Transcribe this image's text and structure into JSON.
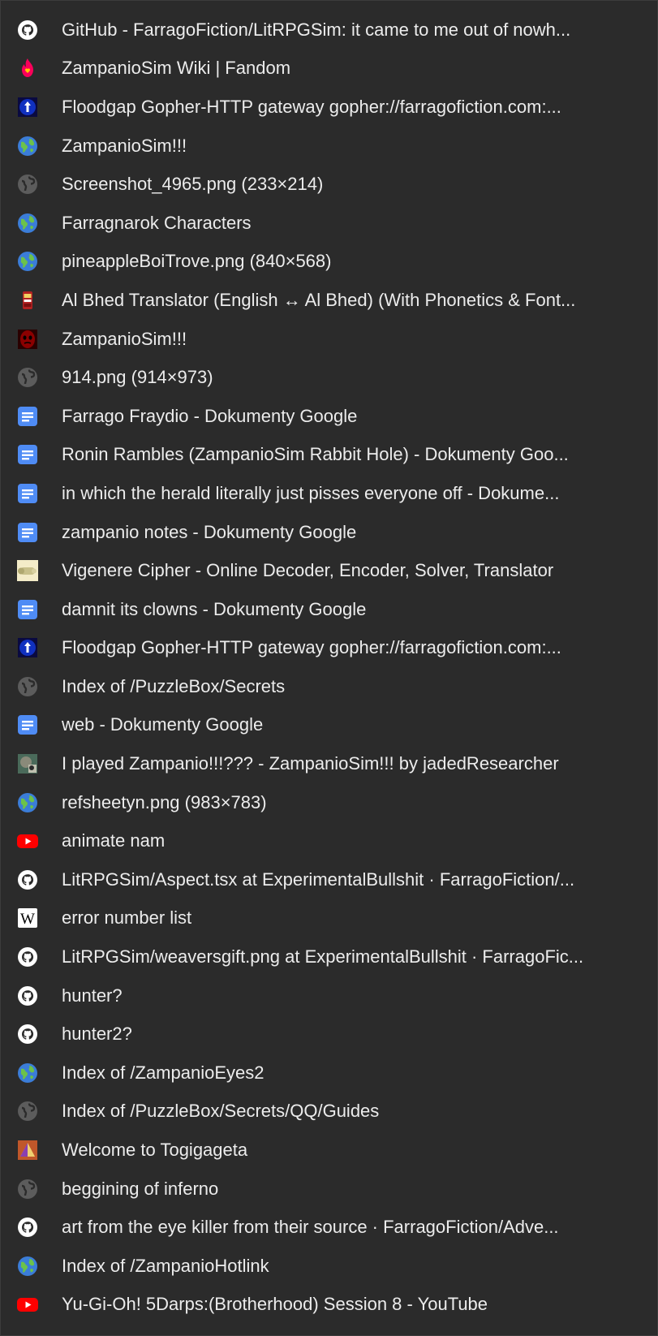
{
  "colors": {
    "menu_background": "#2b2b2b",
    "text": "#ececec",
    "github": "#ffffff",
    "globe_gray": "#5c5c5c",
    "docs_blue": "#4f8cf5",
    "youtube_red": "#ff0000",
    "fandom_pink": "#fa005a",
    "earth_blue": "#3b7dd8",
    "earth_green": "#6cc24a"
  },
  "bookmarks": {
    "items": [
      {
        "icon": "github-icon",
        "title": "GitHub - FarragoFiction/LitRPGSim: it came to me out of nowh..."
      },
      {
        "icon": "fandom-flame-icon",
        "title": "ZampanioSim Wiki | Fandom"
      },
      {
        "icon": "floodgap-icon",
        "title": "Floodgap Gopher-HTTP gateway gopher://farragofiction.com:..."
      },
      {
        "icon": "earth-globe-icon",
        "title": "ZampanioSim!!!"
      },
      {
        "icon": "default-globe-icon",
        "title": "Screenshot_4965.png (233×214)"
      },
      {
        "icon": "earth-globe-icon",
        "title": "Farragnarok Characters"
      },
      {
        "icon": "earth-globe-icon",
        "title": "pineappleBoiTrove.png (840×568)"
      },
      {
        "icon": "al-bhed-icon",
        "title": "Al Bhed Translator (English ↔ Al Bhed) (With Phonetics & Font..."
      },
      {
        "icon": "red-mask-icon",
        "title": "ZampanioSim!!!"
      },
      {
        "icon": "default-globe-icon",
        "title": "914.png (914×973)"
      },
      {
        "icon": "google-docs-icon",
        "title": "Farrago Fraydio - Dokumenty Google"
      },
      {
        "icon": "google-docs-icon",
        "title": "Ronin Rambles (ZampanioSim Rabbit Hole) - Dokumenty Goo..."
      },
      {
        "icon": "google-docs-icon",
        "title": "in which the herald literally just pisses everyone off - Dokume..."
      },
      {
        "icon": "google-docs-icon",
        "title": "zampanio notes - Dokumenty Google"
      },
      {
        "icon": "cipher-scroll-icon",
        "title": "Vigenere Cipher - Online Decoder, Encoder, Solver, Translator"
      },
      {
        "icon": "google-docs-icon",
        "title": "damnit its clowns - Dokumenty Google"
      },
      {
        "icon": "floodgap-icon",
        "title": "Floodgap Gopher-HTTP gateway gopher://farragofiction.com:..."
      },
      {
        "icon": "default-globe-icon",
        "title": "Index of /PuzzleBox/Secrets"
      },
      {
        "icon": "google-docs-icon",
        "title": "web - Dokumenty Google"
      },
      {
        "icon": "itch-avatar-icon",
        "title": "I played Zampanio!!!??? - ZampanioSim!!! by jadedResearcher"
      },
      {
        "icon": "earth-globe-icon",
        "title": "refsheetyn.png (983×783)"
      },
      {
        "icon": "youtube-icon",
        "title": "animate nam"
      },
      {
        "icon": "github-icon",
        "title": "LitRPGSim/Aspect.tsx at ExperimentalBullshit · FarragoFiction/..."
      },
      {
        "icon": "wikipedia-icon",
        "title": "error number list"
      },
      {
        "icon": "github-icon",
        "title": "LitRPGSim/weaversgift.png at ExperimentalBullshit · FarragoFic..."
      },
      {
        "icon": "github-icon",
        "title": "hunter?"
      },
      {
        "icon": "github-icon",
        "title": "hunter2?"
      },
      {
        "icon": "earth-globe-icon",
        "title": "Index of /ZampanioEyes2"
      },
      {
        "icon": "default-globe-icon",
        "title": "Index of /PuzzleBox/Secrets/QQ/Guides"
      },
      {
        "icon": "pyramid-icon",
        "title": "Welcome to Togigageta"
      },
      {
        "icon": "default-globe-icon",
        "title": "beggining of inferno"
      },
      {
        "icon": "github-icon",
        "title": "art from the eye killer from their source · FarragoFiction/Adve..."
      },
      {
        "icon": "earth-globe-icon",
        "title": "Index of /ZampanioHotlink"
      },
      {
        "icon": "youtube-icon",
        "title": "Yu-Gi-Oh! 5Darps:(Brotherhood) Session 8 - YouTube"
      }
    ]
  }
}
